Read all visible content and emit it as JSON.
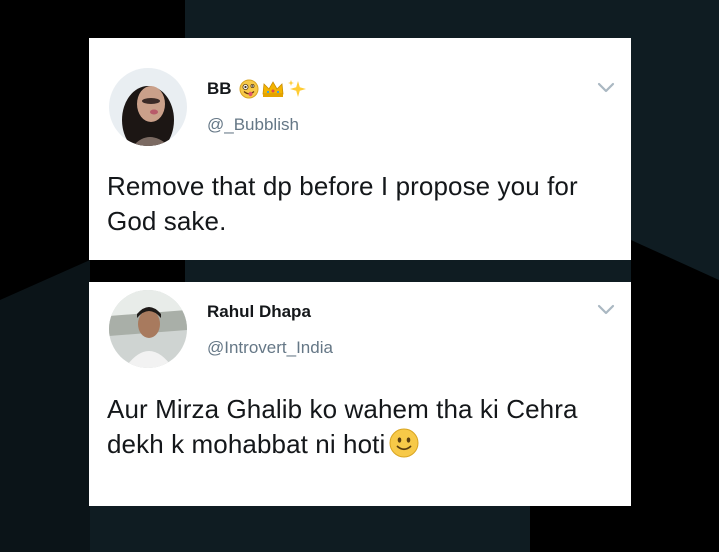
{
  "tweets": [
    {
      "display_name": "BB",
      "name_emojis": [
        "crazy-face-icon",
        "crown-icon",
        "sparkles-icon"
      ],
      "handle": "@_Bubblish",
      "text": "Remove that dp before I propose you for God sake."
    },
    {
      "display_name": "Rahul Dhapa",
      "handle": "@Introvert_India",
      "text": "Aur Mirza Ghalib ko wahem tha ki Cehra dekh k mohabbat ni hoti",
      "trailing_emoji": "slightly-smiling-face-icon"
    }
  ],
  "colors": {
    "background": "#0f1c22",
    "card": "#ffffff",
    "name": "#14171a",
    "handle": "#657786",
    "chevron": "#aab8c2"
  }
}
